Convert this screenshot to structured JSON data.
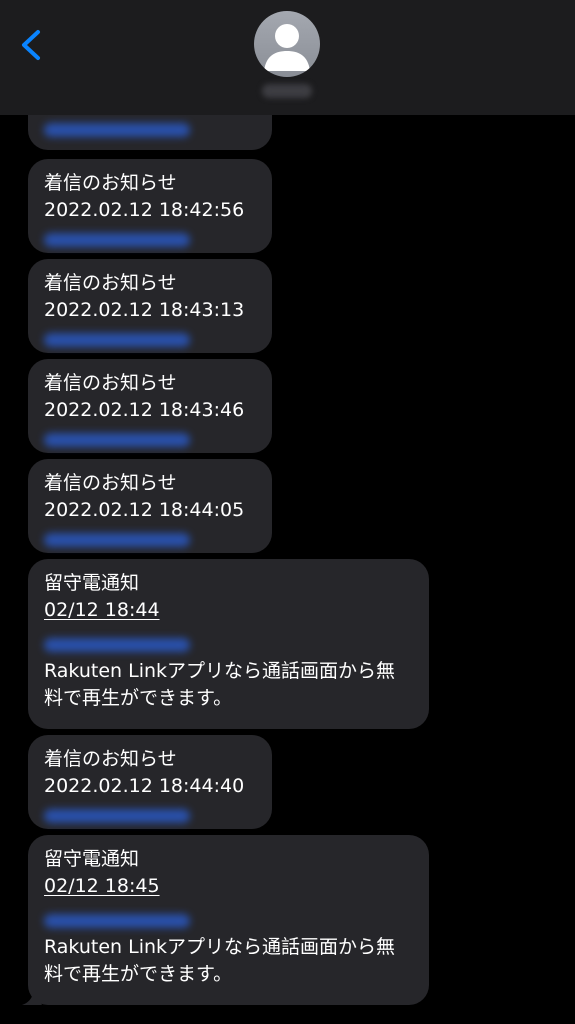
{
  "header": {
    "back_icon": "chevron-left-icon",
    "avatar_icon": "person-silhouette-icon",
    "accent": "#0a84ff"
  },
  "messages": [
    {
      "type": "incoming_call",
      "label": "着信のお知らせ",
      "timestamp": "2022.02.12  18:42:56"
    },
    {
      "type": "incoming_call",
      "label": "着信のお知らせ",
      "timestamp": "2022.02.12  18:43:13"
    },
    {
      "type": "incoming_call",
      "label": "着信のお知らせ",
      "timestamp": "2022.02.12  18:43:46"
    },
    {
      "type": "incoming_call",
      "label": "着信のお知らせ",
      "timestamp": "2022.02.12  18:44:05"
    },
    {
      "type": "voicemail",
      "label": "留守電通知",
      "timestamp": "02/12 18:44",
      "body": "Rakuten Linkアプリなら通話画面から無料で再生ができます。"
    },
    {
      "type": "incoming_call",
      "label": "着信のお知らせ",
      "timestamp": "2022.02.12  18:44:40"
    },
    {
      "type": "voicemail",
      "label": "留守電通知",
      "timestamp": "02/12 18:45",
      "body": "Rakuten Linkアプリなら通話画面から無料で再生ができます。"
    }
  ],
  "colors": {
    "bubble": "#26262a",
    "background": "#000000",
    "link": "#2a55b8",
    "text": "#ffffff"
  }
}
